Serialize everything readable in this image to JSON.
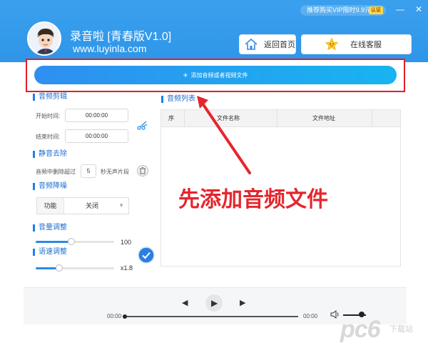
{
  "header": {
    "promo_text": "推荐购买VIP限时9.9元",
    "promo_badge": "认证",
    "app_title": "录音啦 [青春版V1.0]",
    "app_url": "www.luyinla.com",
    "home_button": "返回首页",
    "service_button": "在线客服",
    "minimize": "—",
    "close": "✕"
  },
  "add_bar": {
    "plus": "+",
    "label": "添加音频或者视频文件"
  },
  "sections": {
    "edit": "音频剪辑",
    "start_label": "开始时间:",
    "start_value": "00:00:00",
    "end_label": "结束时间:",
    "end_value": "00:00:00",
    "silence": "静音去除",
    "silence_prefix": "音频中删除超过",
    "silence_value": "5",
    "silence_suffix": "秒无声片段",
    "denoise": "音频降噪",
    "func_label": "功能",
    "func_value": "关闭",
    "volume": "音量调整",
    "volume_value": "100",
    "volume_level": 0.45,
    "speed": "语速调整",
    "speed_value": "x1.8",
    "speed_level": 0.3
  },
  "list": {
    "title": "音频列表",
    "columns": [
      "序",
      "文件名称",
      "文件地址"
    ]
  },
  "annotation": "先添加音频文件",
  "player": {
    "prev": "◀",
    "play": "▶",
    "next": "▶",
    "time_start": "00:00",
    "time_end": "00:00",
    "progress": 0
  },
  "watermark": {
    "main": "pc6",
    "sub": "下载站"
  },
  "colors": {
    "header": "#2f95e8",
    "accent": "#1f7fe8",
    "annotation": "#e5262d"
  }
}
